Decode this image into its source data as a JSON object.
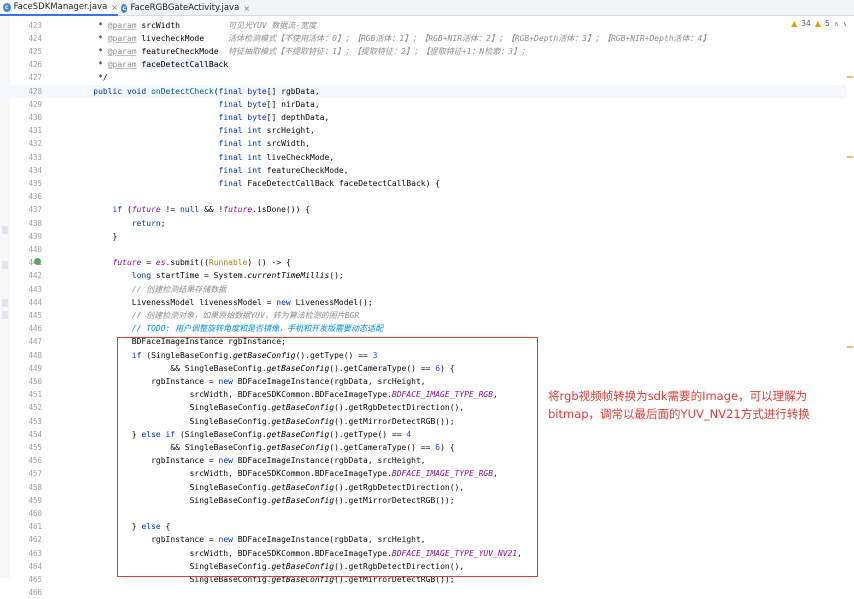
{
  "tabs": [
    {
      "label": "FaceSDKManager.java",
      "active": true
    },
    {
      "label": "FaceRGBGateActivity.java",
      "active": false
    }
  ],
  "status": {
    "warnings": "34",
    "checks": "5"
  },
  "lines": [
    {
      "num": "423",
      "html": "     * <span class=\"tag\">@param</span> <span class=\"docp2\">srcWidth</span>          <span class=\"docc\">可见光YUV 数据流-宽度</span>"
    },
    {
      "num": "424",
      "html": "     * <span class=\"tag\">@param</span> <span class=\"docp2\">livecheckMode</span>     <span class=\"docc\">活体检测模式【不使用活体：0】；【RGB活体：1】；【RGB+NIR活体：2】；【RGB+Depth活体：3】；【RGB+NIR+Depth活体：4】</span>"
    },
    {
      "num": "425",
      "html": "     * <span class=\"tag\">@param</span> <span class=\"docp2\">featureCheckMode</span>  <span class=\"docc\">特征抽取模式【不提取特征：1】；【提取特征：2】；【提取特征+1：N检索：3】；</span>"
    },
    {
      "num": "426",
      "html": "     * <span class=\"tag\">@param</span> <span class=\"docp\">faceDetectCallBack</span>"
    },
    {
      "num": "427",
      "html": "     */"
    },
    {
      "num": "428",
      "hl": true,
      "html": "    <span class=\"kw\">public void</span> <span class=\"fn\">onDetectCheck</span>(<span class=\"kw\">final byte</span>[] rgbData,"
    },
    {
      "num": "429",
      "html": "                              <span class=\"kw\">final byte</span>[] nirData,"
    },
    {
      "num": "430",
      "html": "                              <span class=\"kw\">final byte</span>[] depthData,"
    },
    {
      "num": "431",
      "html": "                              <span class=\"kw\">final int</span> srcHeight,"
    },
    {
      "num": "432",
      "html": "                              <span class=\"kw\">final int</span> srcWidth,"
    },
    {
      "num": "433",
      "html": "                              <span class=\"kw\">final int</span> liveCheckMode,"
    },
    {
      "num": "434",
      "html": "                              <span class=\"kw\">final int</span> featureCheckMode,"
    },
    {
      "num": "435",
      "html": "                              <span class=\"kw\">final</span> FaceDetectCallBack faceDetectCallBack) {"
    },
    {
      "num": "436",
      "html": ""
    },
    {
      "num": "437",
      "html": "        <span class=\"kw\">if</span> (<span class=\"cst\">future</span> != <span class=\"kw\">null</span> &amp;&amp; !<span class=\"cst\">future</span>.isDone()) {"
    },
    {
      "num": "438",
      "html": "            <span class=\"kw\">return</span>;"
    },
    {
      "num": "439",
      "html": "        }"
    },
    {
      "num": "440",
      "html": ""
    },
    {
      "num": "441",
      "html": "        <span class=\"cst\">future</span> = <span class=\"cst\">es</span>.submit((<span class=\"ann\">Runnable</span>) () -&gt; {"
    },
    {
      "num": "442",
      "html": "            <span class=\"kw\">long</span> startTime = System.<span class=\"st\">currentTimeMillis</span>();"
    },
    {
      "num": "443",
      "html": "            <span class=\"cm\">// 创建检测结果存储数据</span>"
    },
    {
      "num": "444",
      "html": "            LivenessModel livenessModel = <span class=\"kw\">new</span> LivenessModel();"
    },
    {
      "num": "445",
      "html": "            <span class=\"cm\">// 创建检测对象，如果原始数据YUV，转为算法检测的图片BGR</span>"
    },
    {
      "num": "446",
      "html": "            <span class=\"todo\">// TODO: 用户调整旋转角度和是否镜像，手机和开发版需要动态适配</span>"
    },
    {
      "num": "447",
      "html": "            BDFaceImageInstance rgbInstance;"
    },
    {
      "num": "448",
      "html": "            <span class=\"kw\">if</span> (SingleBaseConfig.<span class=\"st\">getBaseConfig</span>().getType() == <span class=\"num\">3</span>"
    },
    {
      "num": "449",
      "html": "                    &amp;&amp; SingleBaseConfig.<span class=\"st\">getBaseConfig</span>().getCameraType() == <span class=\"num\">6</span>) {"
    },
    {
      "num": "450",
      "html": "                rgbInstance = <span class=\"kw\">new</span> BDFaceImageInstance(rgbData, srcHeight,"
    },
    {
      "num": "451",
      "html": "                        srcWidth, BDFaceSDKCommon.BDFaceImageType.<span class=\"cst\">BDFACE_IMAGE_TYPE_RGB</span>,"
    },
    {
      "num": "452",
      "html": "                        SingleBaseConfig.<span class=\"st\">getBaseConfig</span>().getRgbDetectDirection(),"
    },
    {
      "num": "453",
      "html": "                        SingleBaseConfig.<span class=\"st\">getBaseConfig</span>().getMirrorDetectRGB());"
    },
    {
      "num": "454",
      "html": "            } <span class=\"kw\">else if</span> (SingleBaseConfig.<span class=\"st\">getBaseConfig</span>().getType() == <span class=\"num\">4</span>"
    },
    {
      "num": "455",
      "html": "                    &amp;&amp; SingleBaseConfig.<span class=\"st\">getBaseConfig</span>().getCameraType() == <span class=\"num\">6</span>) {"
    },
    {
      "num": "456",
      "html": "                rgbInstance = <span class=\"kw\">new</span> BDFaceImageInstance(rgbData, srcHeight,"
    },
    {
      "num": "457",
      "html": "                        srcWidth, BDFaceSDKCommon.BDFaceImageType.<span class=\"cst\">BDFACE_IMAGE_TYPE_RGB</span>,"
    },
    {
      "num": "458",
      "html": "                        SingleBaseConfig.<span class=\"st\">getBaseConfig</span>().getRgbDetectDirection(),"
    },
    {
      "num": "459",
      "html": "                        SingleBaseConfig.<span class=\"st\">getBaseConfig</span>().getMirrorDetectRGB());"
    },
    {
      "num": "460",
      "html": ""
    },
    {
      "num": "461",
      "html": "            } <span class=\"kw\">else</span> {"
    },
    {
      "num": "462",
      "html": "                rgbInstance = <span class=\"kw\">new</span> BDFaceImageInstance(rgbData, srcHeight,"
    },
    {
      "num": "463",
      "html": "                        srcWidth, BDFaceSDKCommon.BDFaceImageType.<span class=\"cst\">BDFACE_IMAGE_TYPE_YUV_NV21</span>,"
    },
    {
      "num": "464",
      "html": "                        SingleBaseConfig.<span class=\"st\">getBaseConfig</span>().getRgbDetectDirection(),"
    },
    {
      "num": "465",
      "html": "                        SingleBaseConfig.<span class=\"st\">getBaseConfig</span>().getMirrorDetectRGB());"
    },
    {
      "num": "466",
      "html": ""
    }
  ],
  "annotation": {
    "text": "将rgb视频帧转换为sdk需要的Image，可以理解为bitmap，调常以最后面的YUV_NV21方式进行转换",
    "color": "#e53935"
  }
}
